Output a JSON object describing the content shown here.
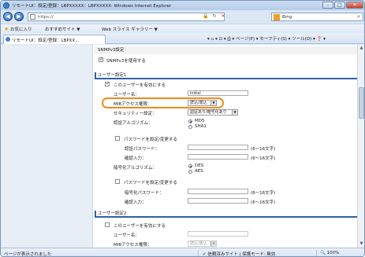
{
  "window": {
    "title": "リモートUI：設定/登録：LBPXXXXX：LBPXXXXX- Windows Internet Explorer",
    "minimize": "–",
    "maximize": "□",
    "close": "✕"
  },
  "address": {
    "back": "◀",
    "forward": "▶",
    "url": "https://",
    "search_label": "Bing",
    "search_icon": "⌕"
  },
  "favorites": {
    "favorites_label": "お気に入り",
    "suggested_sites": "おすすめサイト ▼",
    "web_slice": "Web スライス ギャラリー ▼"
  },
  "tab": {
    "label": "リモートUI：設定/登録：LBPXX..."
  },
  "commandbar": {
    "text": "▾ ▫ ▾ ⊡ ▾ ⎙ ▾ ページ(P) ▾ セーフティ(S) ▾ ツール(O) ▾ ❓ ▾"
  },
  "snmpv3": {
    "header": "SNMPv3設定",
    "use_label": "SNMPv3を使用する"
  },
  "user1": {
    "header": "ユーザー設定1",
    "enable_label": "このユーザーを有効にする",
    "username_label": "ユーザー名：",
    "username_value": "initial",
    "mib_label": "MIBアクセス権限：",
    "mib_value": "読込/書込",
    "security_label": "セキュリティー設定：",
    "security_value": "認証あり/暗号化あり",
    "auth_algo_label": "認証アルゴリズム：",
    "auth_options": [
      "MD5",
      "SHA1"
    ],
    "auth_pw_set_label": "パスワードを設定/変更する",
    "auth_pw_label": "認証パスワード：",
    "auth_pw_hint": "(6〜16文字)",
    "confirm_label": "確認入力：",
    "confirm_hint": "(6〜16文字)",
    "enc_algo_label": "暗号化アルゴリズム：",
    "enc_options": [
      "DES",
      "AES"
    ],
    "enc_pw_set_label": "パスワードを設定/変更する",
    "enc_pw_label": "暗号化パスワード：",
    "enc_pw_hint": "(6〜16文字)",
    "enc_confirm_label": "確認入力：",
    "enc_confirm_hint": "(6〜16文字)"
  },
  "user2": {
    "header": "ユーザー設定2",
    "enable_label": "このユーザーを有効にする",
    "username_label": "ユーザー名：",
    "mib_label": "MIBアクセス権限：",
    "mib_value": "読込/書込"
  },
  "status": {
    "left": "ページが表示されました",
    "zone": "信頼済みサイト | 保護モード: 無効",
    "zoom": "100%"
  },
  "colors": {
    "highlight": "#ef8a1e",
    "section_accent": "#2f5fa8"
  }
}
